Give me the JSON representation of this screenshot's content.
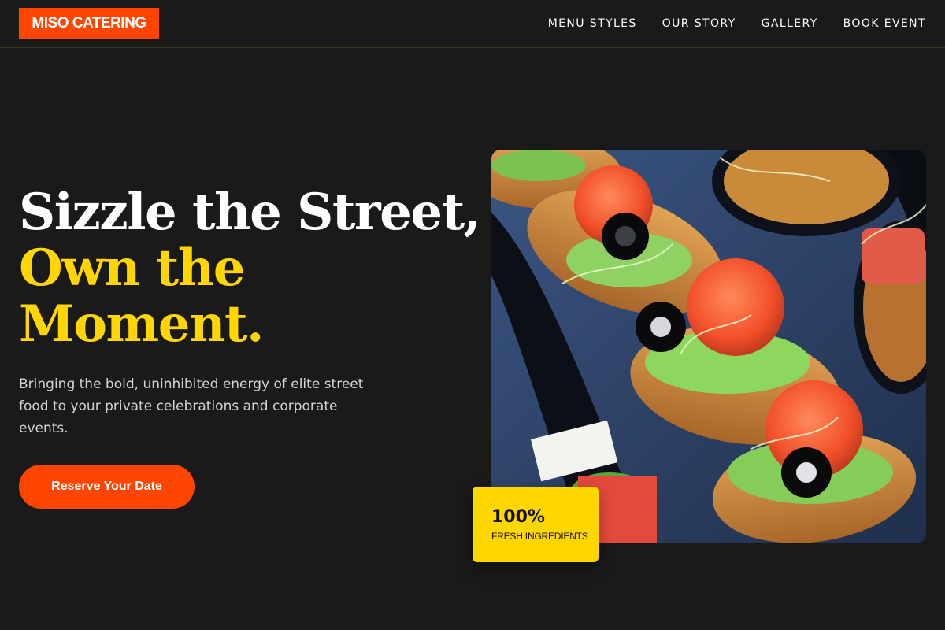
{
  "brand": {
    "logo_text": "MISO CATERING",
    "accent_color": "#ff4500",
    "highlight_color": "#ffd600",
    "background_color": "#1a1a1a"
  },
  "nav": {
    "items": [
      {
        "label": "MENU STYLES"
      },
      {
        "label": "OUR STORY"
      },
      {
        "label": "GALLERY"
      },
      {
        "label": "BOOK EVENT"
      }
    ]
  },
  "hero": {
    "headline_line1": "Sizzle the Street,",
    "headline_line2": "Own the",
    "headline_line3": "Moment.",
    "subtext": "Bringing the bold, uninhibited energy of elite street food to your private celebrations and corporate events.",
    "cta_label": "Reserve Your Date"
  },
  "stat_card": {
    "value": "100%",
    "label": "FRESH INGREDIENTS"
  }
}
